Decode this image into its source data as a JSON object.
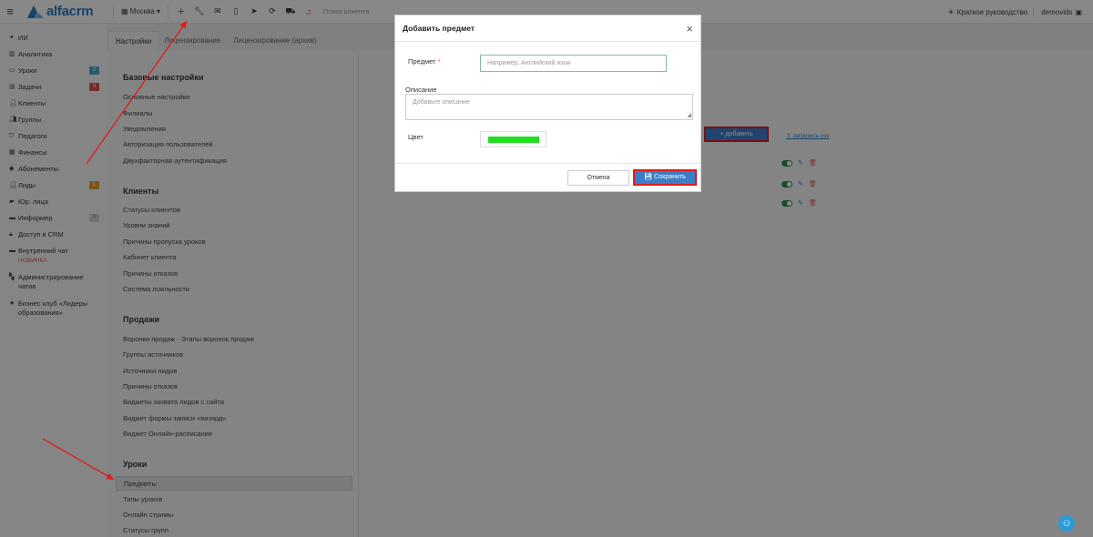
{
  "app": {
    "logo_text": "alfacrm",
    "brand_color": "#2b7bbf"
  },
  "topbar": {
    "branch": "Москва",
    "search_placeholder": "Поиск клиента",
    "guide_label": "Краткое руководство",
    "user_name": "demovids",
    "icons": [
      "plus-icon",
      "wrench-icon",
      "mail-icon",
      "phone-icon",
      "telegram-icon",
      "refresh-icon",
      "cart-icon",
      "bell-icon"
    ]
  },
  "sidebar": {
    "items": [
      {
        "icon": "ai-icon",
        "label": "ИИ"
      },
      {
        "icon": "analytics-icon",
        "label": "Аналитика"
      },
      {
        "icon": "calendar-icon",
        "label": "Уроки",
        "badge": "2",
        "badge_color": "#4aa8c8"
      },
      {
        "icon": "tasks-icon",
        "label": "Задачи",
        "badge": "3",
        "badge_color": "#d9534f"
      },
      {
        "icon": "user-icon",
        "label": "Клиенты"
      },
      {
        "icon": "group-icon",
        "label": "Группы"
      },
      {
        "icon": "teacher-icon",
        "label": "Педагоги"
      },
      {
        "icon": "finance-icon",
        "label": "Финансы"
      },
      {
        "icon": "tag-icon",
        "label": "Абонементы"
      },
      {
        "icon": "leads-icon",
        "label": "Лиды",
        "badge": "1",
        "badge_color": "#e0a02e"
      },
      {
        "icon": "briefcase-icon",
        "label": "Юр. лица"
      },
      {
        "icon": "informer-icon",
        "label": "Информер",
        "badge": "0",
        "badge_color": "#cfcfcf"
      },
      {
        "icon": "lock-icon",
        "label": "Доступ в CRM"
      },
      {
        "icon": "chat-icon",
        "label": "Внутренний чат",
        "sub": "НОВИНКА"
      },
      {
        "icon": "chats-admin-icon",
        "label": "Администрирование чатов"
      },
      {
        "icon": "star-icon",
        "label": "Бизнес клуб «Лидеры образования»"
      }
    ]
  },
  "tabs": [
    {
      "label": "Настройки",
      "active": true
    },
    {
      "label": "Лицензирование"
    },
    {
      "label": "Лицензирование (архив)"
    }
  ],
  "sections": [
    {
      "title": "Базовые настройки",
      "links": [
        "Основные настройки",
        "Филиалы",
        "Уведомления",
        "Авторизация пользователей",
        "Двухфакторная аутентификация"
      ]
    },
    {
      "title": "Клиенты",
      "links": [
        "Статусы клиентов",
        "Уровни знаний",
        "Причины пропуска уроков",
        "Кабинет клиента",
        "Причины отказов",
        "Система лояльности"
      ]
    },
    {
      "title": "Продажи",
      "links": [
        "Воронки продаж - Этапы воронок продаж",
        "Группы источников",
        "Источники лидов",
        "Причины отказов",
        "Виджеты захвата лидов с сайта",
        "Виджет формы записи «визард»",
        "Виджет Онлайн-расписание"
      ]
    },
    {
      "title": "Уроки",
      "links": [
        "Предметы",
        "Типы уроков",
        "Онлайн стримы",
        "Статусы групп"
      ],
      "active_link": "Предметы"
    }
  ],
  "content": {
    "add_label": "+ добавить",
    "upload_label": "загрузить csv"
  },
  "modal": {
    "title": "Добавить предмет",
    "subject_label": "Предмет",
    "required_mark": "*",
    "subject_placeholder": "Например, Английский язык",
    "description_label": "Описание",
    "description_placeholder": "Добавьте описание",
    "color_label": "Цвет",
    "color_value": "#22dd22",
    "cancel_label": "Отмена",
    "save_label": "Сохранить"
  }
}
